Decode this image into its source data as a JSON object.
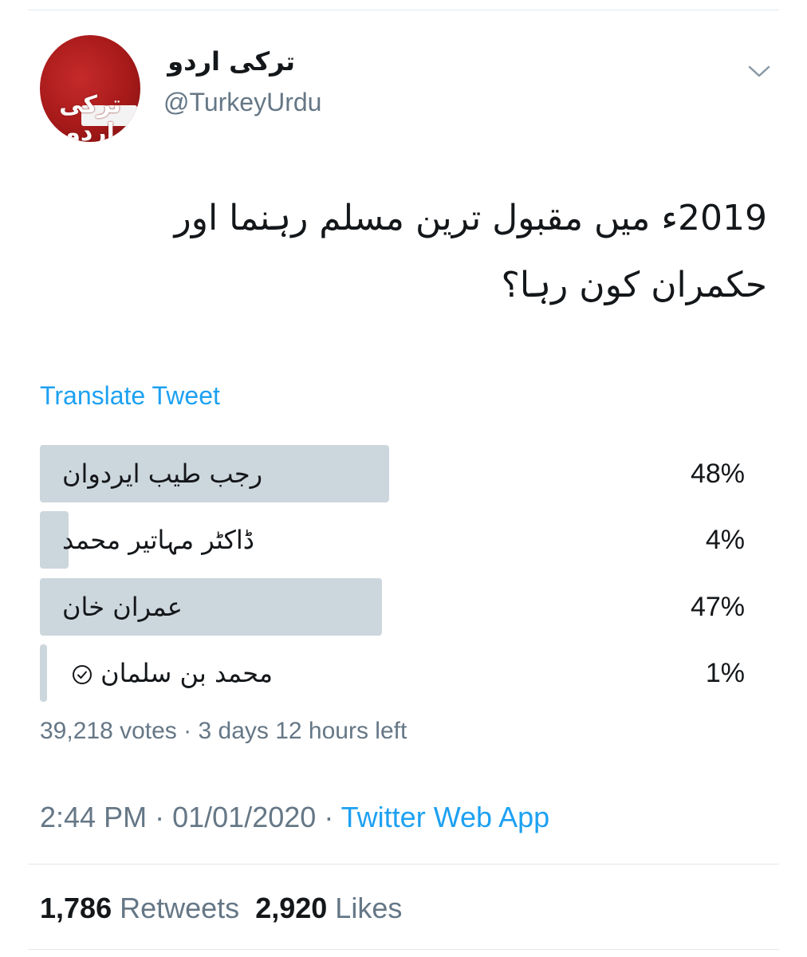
{
  "author": {
    "display_name": "ترکی اردو",
    "handle": "@TurkeyUrdu",
    "avatar_text": "ترکی اردو",
    "avatar_color": "#b51d1d"
  },
  "tweet": {
    "line1": "2019ء میں مقبول ترین مسلم رہنما اور",
    "line2": "حکمران کون رہا؟"
  },
  "translate_label": "Translate Tweet",
  "poll": {
    "options": [
      {
        "label": "رجب طیب ایردوان",
        "percent_text": "48%",
        "percent": 48,
        "winner": false
      },
      {
        "label": "ڈاکٹر مہاتیر محمد",
        "percent_text": "4%",
        "percent": 4,
        "winner": false
      },
      {
        "label": "عمران خان",
        "percent_text": "47%",
        "percent": 47,
        "winner": false
      },
      {
        "label": "محمد بن سلمان",
        "percent_text": "1%",
        "percent": 1,
        "winner": false,
        "selected_by_user": true
      }
    ],
    "votes": "39,218 votes",
    "separator": "·",
    "time_left": "3 days 12 hours left",
    "bar_color": "#ccd6dd"
  },
  "timestamp": {
    "time": "2:44 PM",
    "separator1": "·",
    "date": "01/01/2020",
    "separator2": "·",
    "source": "Twitter Web App"
  },
  "stats": {
    "retweets_count": "1,786",
    "retweets_label": "Retweets",
    "likes_count": "2,920",
    "likes_label": "Likes"
  },
  "colors": {
    "link": "#1da1f2",
    "secondary_text": "#657786",
    "primary_text": "#14171a"
  },
  "icons": {
    "more": "chevron-down-icon",
    "vote_check": "check-circle-icon"
  }
}
